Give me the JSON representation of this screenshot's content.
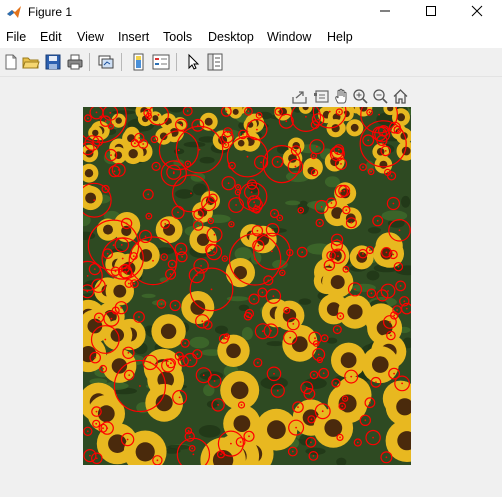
{
  "window": {
    "title": "Figure 1",
    "app_icon": "matlab-logo-icon",
    "controls": [
      "minimize-icon",
      "maximize-icon",
      "close-icon"
    ]
  },
  "menubar": {
    "items": [
      "File",
      "Edit",
      "View",
      "Insert",
      "Tools",
      "Desktop",
      "Window",
      "Help"
    ],
    "pin_icon": "dock-arrow-icon"
  },
  "toolbar": {
    "buttons": [
      "new-figure-icon",
      "open-file-icon",
      "save-icon",
      "print-icon",
      "link-plot-icon",
      "insert-colorbar-icon",
      "insert-legend-icon",
      "edit-plot-arrow-icon",
      "property-inspector-icon"
    ]
  },
  "axes_toolbar": {
    "buttons": [
      "export-icon",
      "brush-icon",
      "pan-hand-icon",
      "zoom-in-icon",
      "zoom-out-icon",
      "home-icon"
    ]
  },
  "figure": {
    "image": "sunflower-field",
    "marker_color": "#ff0000",
    "flower_color": "#e8b820",
    "foliage_color": "#2e4a22"
  }
}
